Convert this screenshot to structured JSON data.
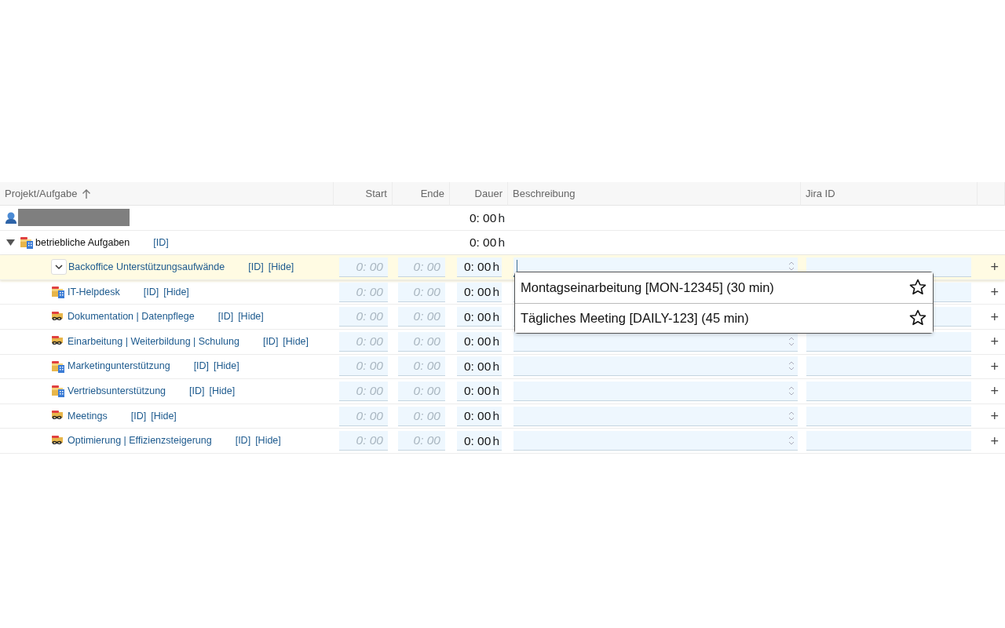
{
  "columns": [
    {
      "label": "Projekt/Aufgabe",
      "sorted": true,
      "ascending": true
    },
    {
      "label": "Start"
    },
    {
      "label": "Ende"
    },
    {
      "label": "Dauer"
    },
    {
      "label": "Beschreibung"
    },
    {
      "label": "Jira ID"
    }
  ],
  "user_row": {
    "duration": "0: 00",
    "unit": "h"
  },
  "group": {
    "name": "betriebliche Aufgaben",
    "expanded": true,
    "id_link": "[ID]",
    "duration": "0: 00",
    "unit": "h",
    "children": [
      {
        "name": "Backoffice Unterstützungsaufwände",
        "selected": true,
        "menu_button": true,
        "description_focused": true,
        "id_link": "[ID]",
        "hide_link": "[Hide]",
        "start_placeholder": "0: 00",
        "end_placeholder": "0: 00",
        "duration": "0: 00",
        "unit": "h",
        "add": "+"
      },
      {
        "name": "IT-Helpdesk",
        "kind": "building",
        "selected": false,
        "menu_button": false,
        "id_link": "[ID]",
        "hide_link": "[Hide]",
        "start_placeholder": "0: 00",
        "end_placeholder": "0: 00",
        "duration": "0: 00",
        "unit": "h",
        "add": "+"
      },
      {
        "name": "Dokumentation | Datenpflege",
        "kind": "recurring",
        "selected": false,
        "menu_button": false,
        "id_link": "[ID]",
        "hide_link": "[Hide]",
        "start_placeholder": "0: 00",
        "end_placeholder": "0: 00",
        "duration": "0: 00",
        "unit": "h",
        "add": "+"
      },
      {
        "name": "Einarbeitung | Weiterbildung | Schulung",
        "kind": "recurring",
        "selected": false,
        "menu_button": false,
        "id_link": "[ID]",
        "hide_link": "[Hide]",
        "start_placeholder": "0: 00",
        "end_placeholder": "0: 00",
        "duration": "0: 00",
        "unit": "h",
        "add": "+"
      },
      {
        "name": "Marketingunterstützung",
        "kind": "building",
        "selected": false,
        "menu_button": false,
        "id_link": "[ID]",
        "hide_link": "[Hide]",
        "start_placeholder": "0: 00",
        "end_placeholder": "0: 00",
        "duration": "0: 00",
        "unit": "h",
        "add": "+"
      },
      {
        "name": "Vertriebsunterstützung",
        "kind": "building",
        "selected": false,
        "menu_button": false,
        "id_link": "[ID]",
        "hide_link": "[Hide]",
        "start_placeholder": "0: 00",
        "end_placeholder": "0: 00",
        "duration": "0: 00",
        "unit": "h",
        "add": "+"
      },
      {
        "name": "Meetings",
        "kind": "recurring",
        "selected": false,
        "menu_button": false,
        "id_link": "[ID]",
        "hide_link": "[Hide]",
        "start_placeholder": "0: 00",
        "end_placeholder": "0: 00",
        "duration": "0: 00",
        "unit": "h",
        "add": "+"
      },
      {
        "name": "Optimierung | Effizienzsteigerung",
        "kind": "recurring",
        "selected": false,
        "menu_button": false,
        "id_link": "[ID]",
        "hide_link": "[Hide]",
        "start_placeholder": "0: 00",
        "end_placeholder": "0: 00",
        "duration": "0: 00",
        "unit": "h",
        "add": "+"
      }
    ]
  },
  "suggestions": [
    {
      "text": "Montagseinarbeitung [MON-12345] (30 min)",
      "starred": false
    },
    {
      "text": "Tägliches Meeting [DAILY-123] (45 min)",
      "starred": false
    }
  ]
}
